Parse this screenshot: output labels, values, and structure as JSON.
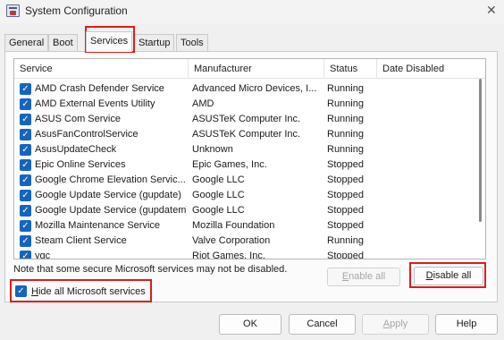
{
  "window": {
    "title": "System Configuration",
    "close_glyph": "✕"
  },
  "tabs": [
    {
      "label": "General"
    },
    {
      "label": "Boot"
    },
    {
      "label": "Services",
      "active": true
    },
    {
      "label": "Startup"
    },
    {
      "label": "Tools"
    }
  ],
  "columns": [
    "Service",
    "Manufacturer",
    "Status",
    "Date Disabled"
  ],
  "services": [
    {
      "name": "AMD Crash Defender Service",
      "manufacturer": "Advanced Micro Devices, I...",
      "status": "Running",
      "date": "",
      "checked": true
    },
    {
      "name": "AMD External Events Utility",
      "manufacturer": "AMD",
      "status": "Running",
      "date": "",
      "checked": true
    },
    {
      "name": "ASUS Com Service",
      "manufacturer": "ASUSTeK Computer Inc.",
      "status": "Running",
      "date": "",
      "checked": true
    },
    {
      "name": "AsusFanControlService",
      "manufacturer": "ASUSTeK Computer Inc.",
      "status": "Running",
      "date": "",
      "checked": true
    },
    {
      "name": "AsusUpdateCheck",
      "manufacturer": "Unknown",
      "status": "Running",
      "date": "",
      "checked": true
    },
    {
      "name": "Epic Online Services",
      "manufacturer": "Epic Games, Inc.",
      "status": "Stopped",
      "date": "",
      "checked": true
    },
    {
      "name": "Google Chrome Elevation Servic...",
      "manufacturer": "Google LLC",
      "status": "Stopped",
      "date": "",
      "checked": true
    },
    {
      "name": "Google Update Service (gupdate)",
      "manufacturer": "Google LLC",
      "status": "Stopped",
      "date": "",
      "checked": true
    },
    {
      "name": "Google Update Service (gupdatem)",
      "manufacturer": "Google LLC",
      "status": "Stopped",
      "date": "",
      "checked": true
    },
    {
      "name": "Mozilla Maintenance Service",
      "manufacturer": "Mozilla Foundation",
      "status": "Stopped",
      "date": "",
      "checked": true
    },
    {
      "name": "Steam Client Service",
      "manufacturer": "Valve Corporation",
      "status": "Running",
      "date": "",
      "checked": true
    },
    {
      "name": "vgc",
      "manufacturer": "Riot Games, Inc.",
      "status": "Stopped",
      "date": "",
      "checked": true
    }
  ],
  "note": "Note that some secure Microsoft services may not be disabled.",
  "buttons": {
    "enable_all": {
      "mnemonic": "E",
      "rest": "nable all",
      "enabled": false
    },
    "disable_all": {
      "mnemonic": "D",
      "rest": "isable all",
      "enabled": true
    },
    "ok": "OK",
    "cancel": "Cancel",
    "apply": {
      "mnemonic": "A",
      "rest": "pply",
      "enabled": false
    },
    "help": "Help"
  },
  "hide_ms": {
    "mnemonic": "H",
    "rest": "ide all Microsoft services",
    "checked": true
  },
  "colors": {
    "accent": "#1565c0",
    "highlight": "#e01b1b"
  }
}
